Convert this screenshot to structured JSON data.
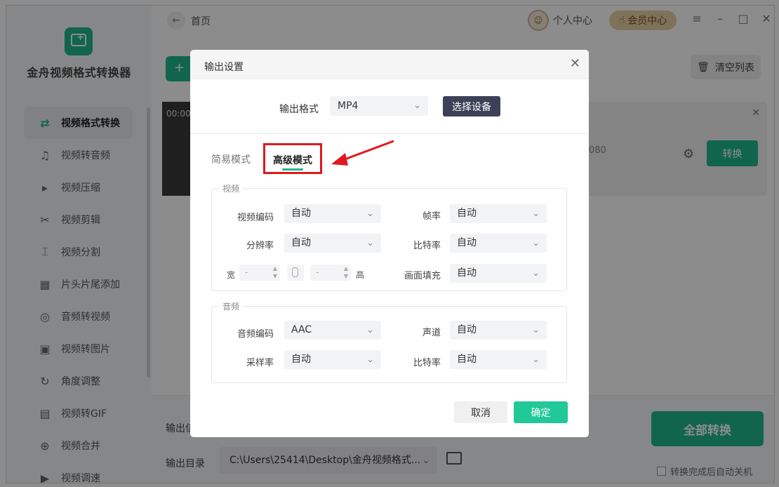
{
  "app": {
    "name": "金舟视频格式转换器",
    "breadcrumb": "首页",
    "personal_center": "个人中心",
    "vip_center": "会员中心",
    "clear_list": "清空列表",
    "add_label": "+"
  },
  "sidebar": {
    "items": [
      {
        "label": "视频格式转换",
        "icon": "convert-icon",
        "active": true
      },
      {
        "label": "视频转音频",
        "icon": "music-icon"
      },
      {
        "label": "视频压缩",
        "icon": "compress-icon"
      },
      {
        "label": "视频剪辑",
        "icon": "scissors-icon"
      },
      {
        "label": "视频分割",
        "icon": "split-icon"
      },
      {
        "label": "片头片尾添加",
        "icon": "film-icon"
      },
      {
        "label": "音频转视频",
        "icon": "audio-disc-icon"
      },
      {
        "label": "视频转图片",
        "icon": "image-icon"
      },
      {
        "label": "角度调整",
        "icon": "rotate-icon"
      },
      {
        "label": "视频转GIF",
        "icon": "gif-icon"
      },
      {
        "label": "视频合并",
        "icon": "merge-icon"
      },
      {
        "label": "视频调速",
        "icon": "speed-icon"
      }
    ]
  },
  "file_card": {
    "time": "00:00:",
    "resolution": "080",
    "convert_label": "转换"
  },
  "bottom": {
    "output_info_label": "输出信",
    "output_dir_label": "输出目录",
    "output_path": "C:\\Users\\25414\\Desktop\\金舟视频格式...",
    "convert_all": "全部转换",
    "auto_shutdown": "转换完成后自动关机"
  },
  "dialog": {
    "title": "输出设置",
    "format_label": "输出格式",
    "format_value": "MP4",
    "select_device": "选择设备",
    "tab_simple": "简易模式",
    "tab_advanced": "高级模式",
    "video_group": "视频",
    "audio_group": "音频",
    "video_fields": {
      "codec_label": "视频编码",
      "codec_value": "自动",
      "fps_label": "帧率",
      "fps_value": "自动",
      "resolution_label": "分辨率",
      "resolution_value": "自动",
      "bitrate_label": "比特率",
      "bitrate_value": "自动",
      "width_label": "宽",
      "width_value": "-",
      "height_label": "高",
      "height_value": "-",
      "fill_label": "画面填充",
      "fill_value": "自动"
    },
    "audio_fields": {
      "codec_label": "音频编码",
      "codec_value": "AAC",
      "channel_label": "声道",
      "channel_value": "自动",
      "samplerate_label": "采样率",
      "samplerate_value": "自动",
      "bitrate_label": "比特率",
      "bitrate_value": "自动"
    },
    "cancel": "取消",
    "ok": "确定"
  },
  "colors": {
    "accent": "#20b98a",
    "highlight_red": "#e0191f",
    "device_button": "#3d4158"
  }
}
